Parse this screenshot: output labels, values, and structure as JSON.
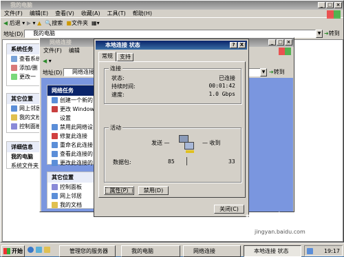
{
  "mycomputer": {
    "title": "我的电脑",
    "menu": [
      "文件(F)",
      "编辑(E)",
      "查看(V)",
      "收藏(A)",
      "工具(T)",
      "帮助(H)"
    ],
    "toolbar": {
      "back": "后退",
      "search": "搜索",
      "folders": "文件夹"
    },
    "address_label": "地址(D)",
    "address_value": "我的电脑",
    "go": "转到",
    "system_tasks_title": "系统任务",
    "system_tasks": [
      "查看系统",
      "添加/删",
      "更改一"
    ],
    "other_places_title": "其它位置",
    "other_places": [
      "网上邻居",
      "我的文档",
      "控制面板"
    ],
    "details_title": "详细信息",
    "details_name": "我的电脑",
    "details_desc": "系统文件夹"
  },
  "netconn": {
    "title": "网络连接",
    "menu": [
      "文件(F)",
      "编辑"
    ],
    "address_label": "地址(D)",
    "address_value": "网络连接",
    "go": "转到",
    "tasks_title": "网络任务",
    "tasks": [
      "创建一个新的",
      "更改 Windows",
      "设置",
      "禁用此网络设",
      "修复此连接",
      "重命名此连接",
      "查看此连接的",
      "更改此连接的"
    ],
    "other_title": "其它位置",
    "other": [
      "控制面板",
      "网上邻居",
      "我的文档"
    ]
  },
  "status": {
    "title": "本地连接 状态",
    "help": "?",
    "close_x": "X",
    "tabs": [
      "常规",
      "支持"
    ],
    "conn_group": "连接",
    "rows": [
      {
        "label": "状态:",
        "value": "已连接"
      },
      {
        "label": "持续时间:",
        "value": "00:01:42"
      },
      {
        "label": "速度:",
        "value": "1.0 Gbps"
      }
    ],
    "activity_group": "活动",
    "sent_label": "发送 —",
    "recv_label": "— 收到",
    "packets_label": "数据包:",
    "sent_value": "85",
    "recv_value": "33",
    "properties_btn": "属性(P)",
    "disable_btn": "禁用(D)",
    "close_btn": "关闭(C)"
  },
  "taskbar": {
    "start": "开始",
    "buttons": [
      "管理您的服务器",
      "我的电脑",
      "网络连接",
      "本地连接 状态"
    ],
    "clock": "19:17"
  },
  "watermark": "Bai 经验",
  "watermark_url": "jingyan.baidu.com"
}
